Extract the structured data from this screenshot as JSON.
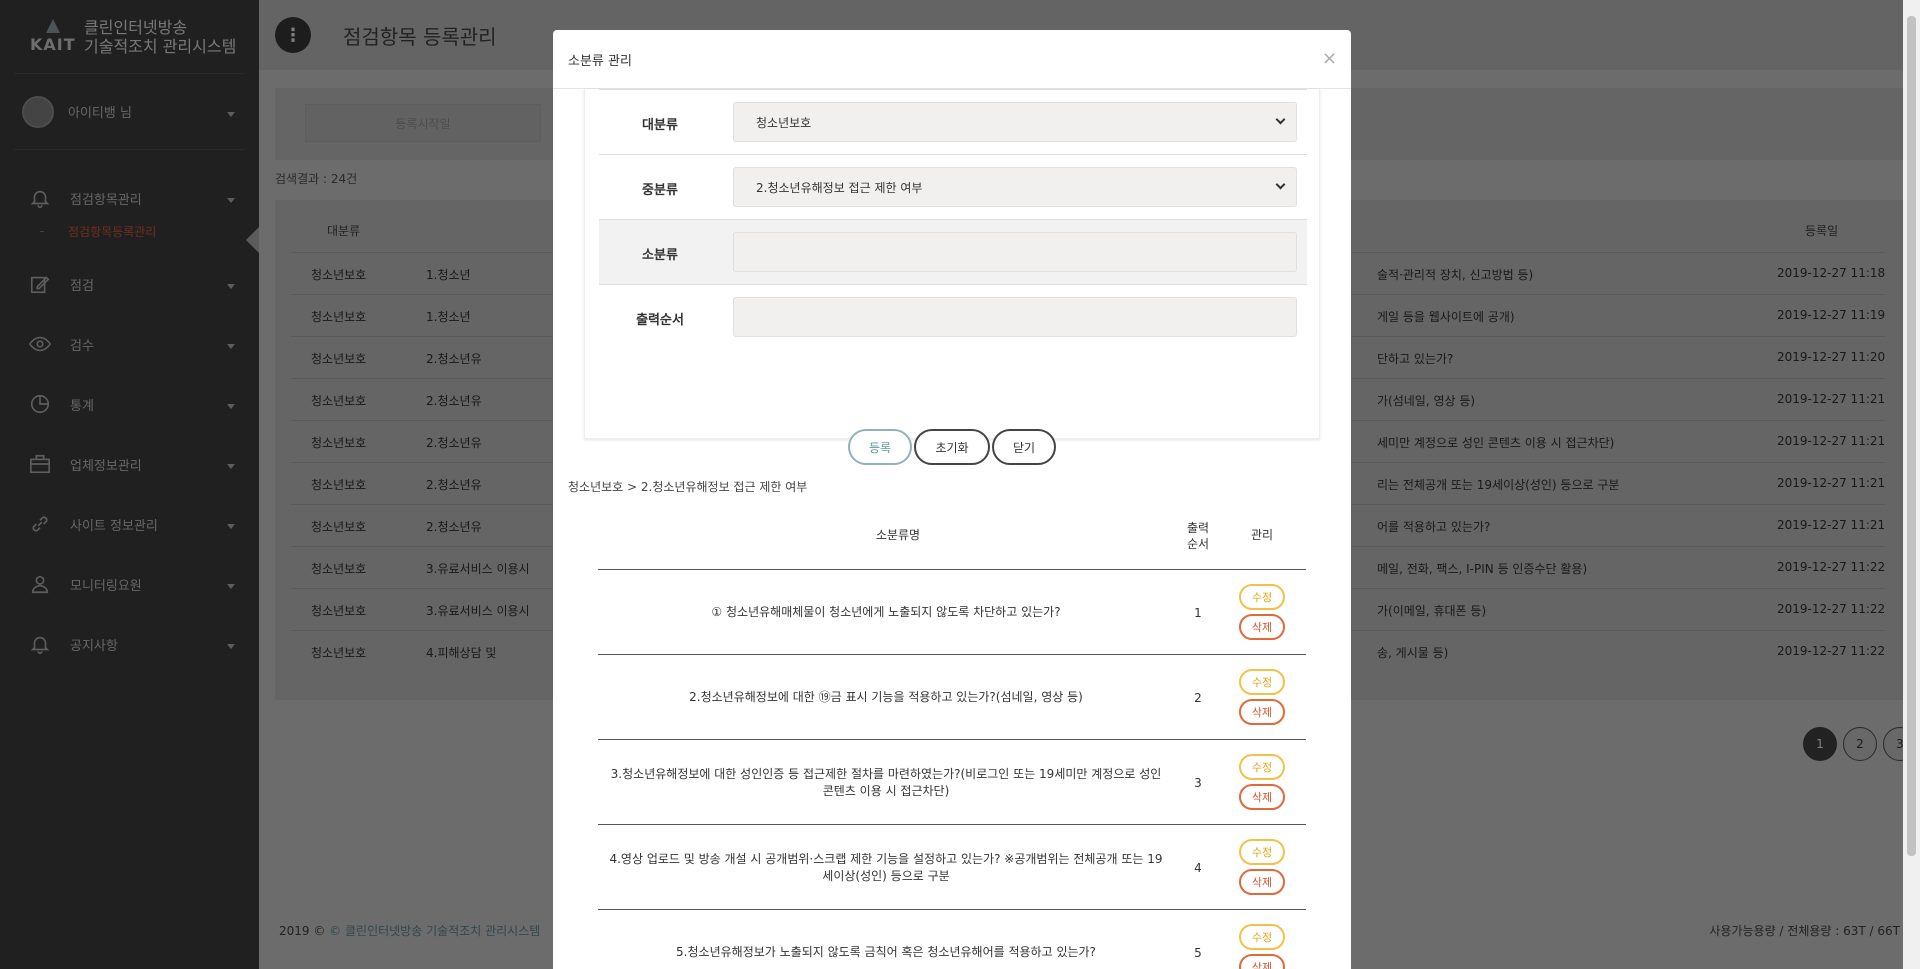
{
  "app": {
    "logo_text": "KAIT",
    "title_line1": "클린인터넷방송",
    "title_line2": "기술적조치 관리시스템"
  },
  "user": {
    "name": "아이티뱅 님"
  },
  "sidebar": {
    "items": [
      {
        "label": "점검항목관리",
        "icon": "bell-icon"
      },
      {
        "label": "점검",
        "icon": "edit-icon"
      },
      {
        "label": "검수",
        "icon": "eye-icon"
      },
      {
        "label": "통계",
        "icon": "pie-chart-icon"
      },
      {
        "label": "업체정보관리",
        "icon": "briefcase-icon"
      },
      {
        "label": "사이트 정보관리",
        "icon": "link-icon"
      },
      {
        "label": "모니터링요원",
        "icon": "user-icon"
      },
      {
        "label": "공지사항",
        "icon": "bell-icon"
      }
    ],
    "sub_active": "점검항목등록관리"
  },
  "page": {
    "title": "점검항목 등록관리",
    "search_placeholder": "등록시작일",
    "result_count": "검색결과 : 24건",
    "columns": {
      "category": "대분류",
      "date": "등록일"
    },
    "rows": [
      {
        "cat": "청소년보호",
        "mid": "1.청소년",
        "tail": "술적·관리적 장치, 신고방법 등)",
        "date": "2019-12-27 11:18"
      },
      {
        "cat": "청소년보호",
        "mid": "1.청소년",
        "tail": "게일 등을 웹사이트에 공개)",
        "date": "2019-12-27 11:19"
      },
      {
        "cat": "청소년보호",
        "mid": "2.청소년유",
        "tail": "단하고 있는가?",
        "date": "2019-12-27 11:20"
      },
      {
        "cat": "청소년보호",
        "mid": "2.청소년유",
        "tail": "가(섬네일, 영상 등)",
        "date": "2019-12-27 11:21"
      },
      {
        "cat": "청소년보호",
        "mid": "2.청소년유",
        "tail": "세미만 계정으로 성인 콘텐츠 이용 시 접근차단)",
        "date": "2019-12-27 11:21"
      },
      {
        "cat": "청소년보호",
        "mid": "2.청소년유",
        "tail": "리는 전체공개 또는 19세이상(성인) 등으로 구분",
        "date": "2019-12-27 11:21"
      },
      {
        "cat": "청소년보호",
        "mid": "2.청소년유",
        "tail": "어를 적용하고 있는가?",
        "date": "2019-12-27 11:21"
      },
      {
        "cat": "청소년보호",
        "mid": "3.유료서비스 이용시",
        "tail": "메일, 전화, 팩스, I-PIN 등 인증수단 활용)",
        "date": "2019-12-27 11:22"
      },
      {
        "cat": "청소년보호",
        "mid": "3.유료서비스 이용시",
        "tail": "가(이메일, 휴대폰 등)",
        "date": "2019-12-27 11:22"
      },
      {
        "cat": "청소년보호",
        "mid": "4.피해상담 및",
        "tail": "송, 게시물 등)",
        "date": "2019-12-27 11:22"
      }
    ],
    "pages": [
      "1",
      "2",
      "3"
    ]
  },
  "footer": {
    "copyright": "2019 © ",
    "link": "© 클린인터넷방송 기술적조치 관리시스템",
    "storage": "사용가능용량 / 전체용량 : 63T / 66T"
  },
  "modal": {
    "title": "소분류 관리",
    "close": "×",
    "fields": {
      "major_label": "대분류",
      "major_value": "청소년보호",
      "middle_label": "중분류",
      "middle_value": "2.청소년유해정보 접근 제한 여부",
      "minor_label": "소분류",
      "minor_value": "",
      "order_label": "출력순서",
      "order_value": ""
    },
    "buttons": {
      "register": "등록",
      "reset": "초기화",
      "close": "닫기"
    },
    "breadcrumb": "청소년보호 > 2.청소년유해정보 접근 제한 여부",
    "list": {
      "col_name": "소분류명",
      "col_order_1": "출력",
      "col_order_2": "순서",
      "col_manage": "관리",
      "edit_label": "수정",
      "delete_label": "삭제",
      "items": [
        {
          "name": "① 청소년유해매체물이 청소년에게 노출되지 않도록 차단하고 있는가?",
          "order": "1"
        },
        {
          "name": "2.청소년유해정보에 대한 ⑲금 표시 기능을 적용하고 있는가?(섬네일, 영상 등)",
          "order": "2"
        },
        {
          "name": "3.청소년유해정보에 대한 성인인증 등 접근제한 절차를 마련하였는가?(비로그인 또는 19세미만 계정으로 성인 콘텐츠 이용 시 접근차단)",
          "order": "3"
        },
        {
          "name": "4.영상 업로드 및 방송 개설 시 공개범위·스크랩 제한 기능을 설정하고 있는가? ※공개범위는 전체공개 또는 19세이상(성인) 등으로 구분",
          "order": "4"
        },
        {
          "name": "5.청소년유해정보가 노출되지 않도록 금칙어 혹은 청소년유해어를 적용하고 있는가?",
          "order": "5"
        }
      ]
    }
  }
}
